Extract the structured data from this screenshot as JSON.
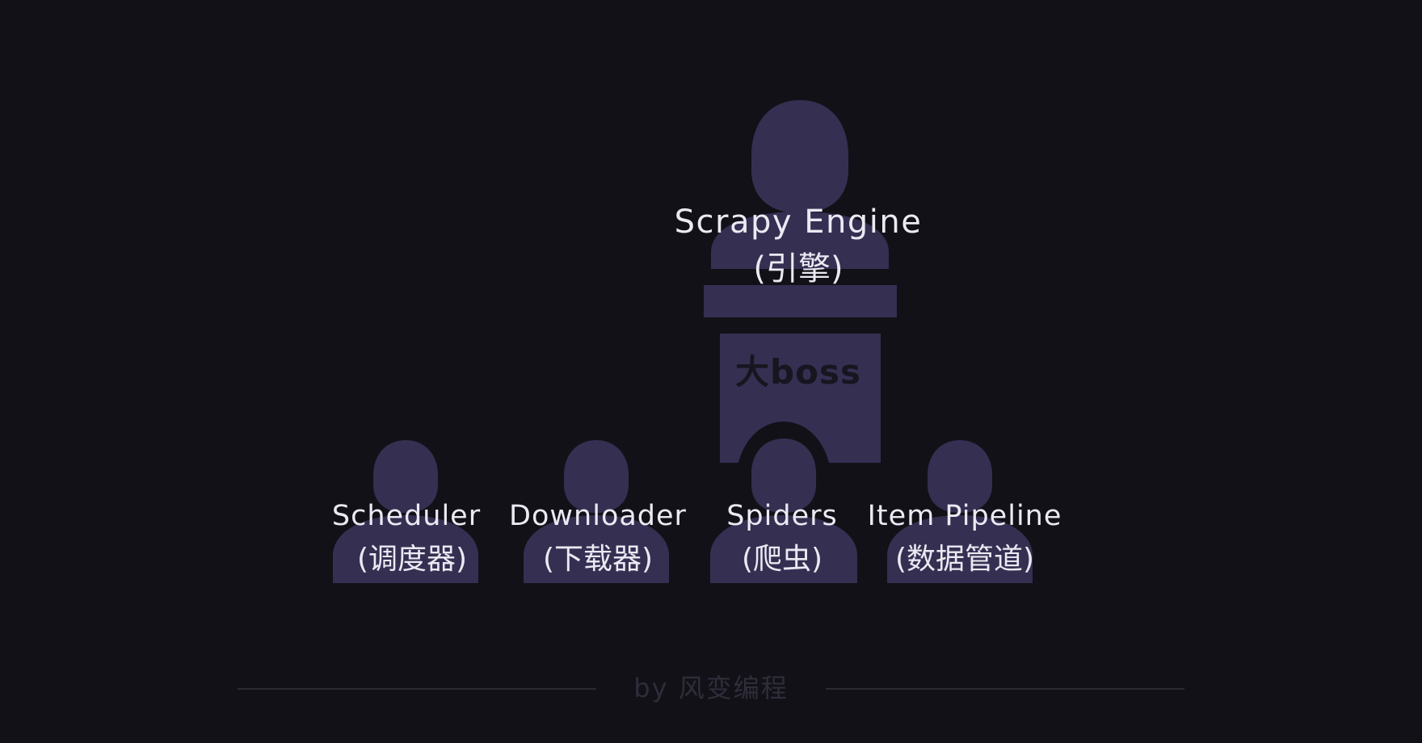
{
  "engine": {
    "name": "Scrapy Engine",
    "role": "(引擎)",
    "podium_label": "大boss"
  },
  "components": [
    {
      "name": "Scheduler",
      "role": "(调度器)"
    },
    {
      "name": "Downloader",
      "role": "(下载器)"
    },
    {
      "name": "Spiders",
      "role": "(爬虫)"
    },
    {
      "name": "Item Pipeline",
      "role": "(数据管道)"
    }
  ],
  "footer": {
    "credit": "by 风变编程"
  },
  "colors": {
    "background": "#121118",
    "figure": "#352f52",
    "text": "#ebe9f2",
    "credit": "#2f2d39"
  }
}
